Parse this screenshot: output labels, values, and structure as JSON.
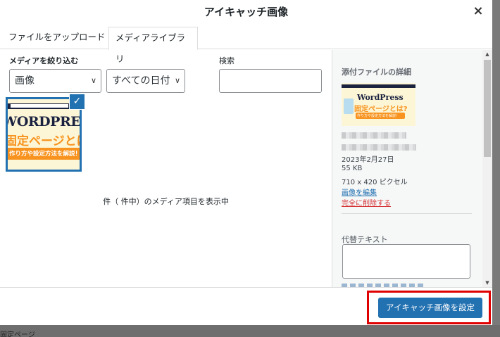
{
  "modal": {
    "title": "アイキャッチ画像",
    "close_symbol": "×"
  },
  "tabs": [
    {
      "label": "ファイルをアップロード",
      "active": false
    },
    {
      "label": "メディアライブラリ",
      "active": true
    }
  ],
  "filters": {
    "label": "メディアを絞り込む",
    "type_value": "画像",
    "date_value": "すべての日付",
    "search_label": "検索",
    "search_value": ""
  },
  "attachment": {
    "selected": true,
    "thumb_title": "WORDPRESS",
    "thumb_subtitle": "固定ページとは",
    "thumb_band": "作り方や設定方法を解説！"
  },
  "count_text": "件（ 件中）のメディア項目を表示中",
  "details": {
    "title": "添付ファイルの詳細",
    "thumb_title": "WordPress",
    "thumb_subtitle": "固定ページとは?",
    "thumb_band": "作り方や設定方法を解説！",
    "date": "2023年2月27日",
    "size": "55 KB",
    "dimensions": "710 x 420 ピクセル",
    "edit_link": "画像を編集",
    "delete_link": "完全に削除する",
    "alt_label": "代替テキスト",
    "alt_value": ""
  },
  "toolbar": {
    "set_button": "アイキャッチ画像を設定"
  },
  "colors": {
    "primary": "#2271b1",
    "danger": "#d63638",
    "highlight": "#e00000",
    "accent_orange": "#f7931e",
    "navy": "#1a2240"
  },
  "backdrop_text": "固定ページ"
}
